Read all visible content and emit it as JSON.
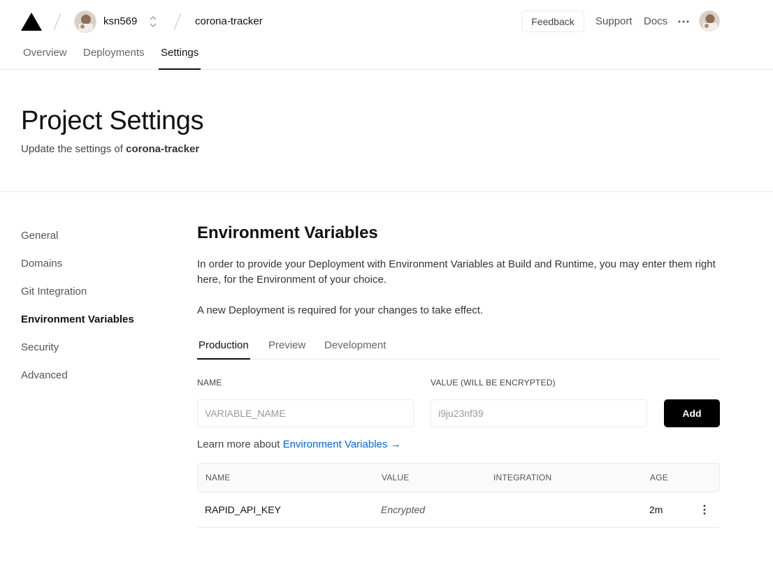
{
  "header": {
    "team": "ksn569",
    "project": "corona-tracker",
    "feedback_label": "Feedback",
    "support_label": "Support",
    "docs_label": "Docs",
    "tabs": [
      {
        "label": "Overview"
      },
      {
        "label": "Deployments"
      },
      {
        "label": "Settings"
      }
    ]
  },
  "page": {
    "title": "Project Settings",
    "subtitle_prefix": "Update the settings of ",
    "subtitle_project": "corona-tracker"
  },
  "sidebar": {
    "items": [
      {
        "label": "General"
      },
      {
        "label": "Domains"
      },
      {
        "label": "Git Integration"
      },
      {
        "label": "Environment Variables"
      },
      {
        "label": "Security"
      },
      {
        "label": "Advanced"
      }
    ]
  },
  "main": {
    "title": "Environment Variables",
    "description": "In order to provide your Deployment with Environment Variables at Build and Runtime, you may enter them right here, for the Environment of your choice.",
    "notice": "A new Deployment is required for your changes to take effect.",
    "env_tabs": [
      {
        "label": "Production"
      },
      {
        "label": "Preview"
      },
      {
        "label": "Development"
      }
    ],
    "form": {
      "name_label": "NAME",
      "value_label": "VALUE (WILL BE ENCRYPTED)",
      "name_placeholder": "VARIABLE_NAME",
      "value_placeholder": "i9ju23nf39",
      "add_label": "Add"
    },
    "learn_prefix": "Learn more about ",
    "learn_link": "Environment Variables →",
    "table": {
      "headers": [
        "NAME",
        "VALUE",
        "INTEGRATION",
        "AGE"
      ],
      "rows": [
        {
          "name": "RAPID_API_KEY",
          "value": "Encrypted",
          "integration": "",
          "age": "2m"
        }
      ]
    }
  }
}
